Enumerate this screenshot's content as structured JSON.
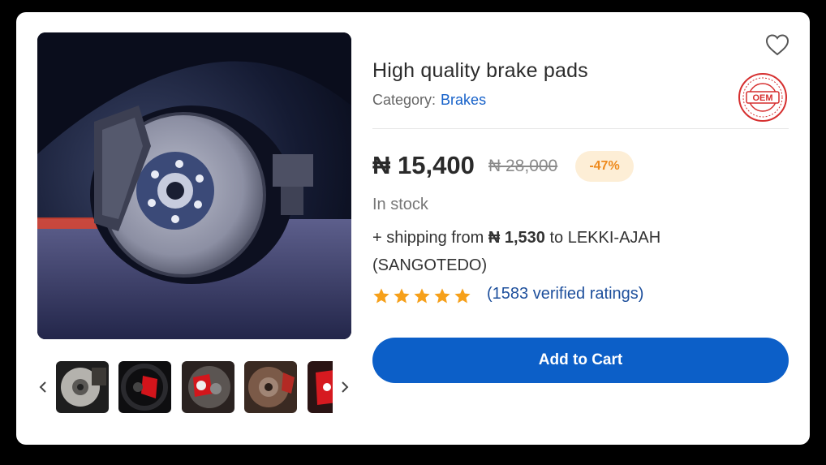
{
  "product": {
    "title": "High quality brake pads",
    "category_label": "Category:",
    "category_value": "Brakes",
    "price": "₦ 15,400",
    "old_price": "₦ 28,000",
    "discount": "-47%",
    "stock": "In stock",
    "shipping_prefix": "+ shipping from ",
    "shipping_amount": "₦ 1,530",
    "shipping_suffix": " to LEKKI-AJAH (SANGOTEDO)",
    "rating_stars": 5,
    "ratings_text": "(1583 verified ratings)",
    "badge_text": "OEM"
  },
  "actions": {
    "add_to_cart": "Add to Cart"
  },
  "colors": {
    "accent": "#0c5fc8",
    "link": "#1661c9",
    "star": "#f6a01a",
    "discount_bg": "#fdeed6",
    "discount_text": "#ee8a1d",
    "badge_red": "#d62f2f"
  },
  "icons": {
    "favorite": "heart-outline-icon",
    "prev": "chevron-left-icon",
    "next": "chevron-right-icon",
    "star": "star-filled-icon"
  },
  "gallery": {
    "thumbnails": [
      "brake-disc-silver",
      "red-caliper-black-wheel",
      "red-caliper-brembo",
      "brake-disc-rust",
      "red-caliper-partial"
    ]
  }
}
